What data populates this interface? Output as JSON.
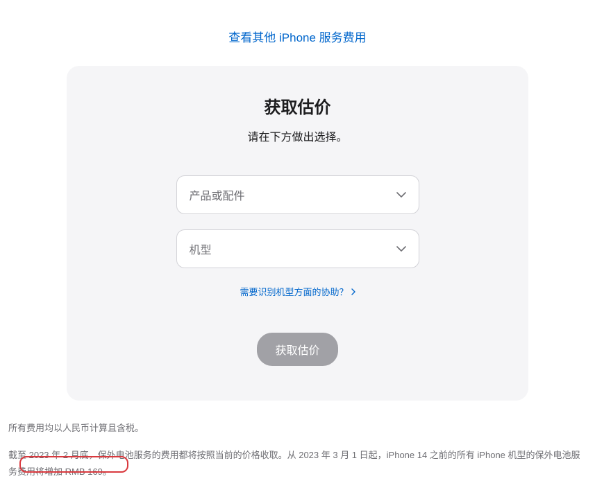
{
  "topLink": "查看其他 iPhone 服务费用",
  "card": {
    "title": "获取估价",
    "subtitle": "请在下方做出选择。",
    "select1Placeholder": "产品或配件",
    "select2Placeholder": "机型",
    "helpLink": "需要识别机型方面的协助？",
    "submitLabel": "获取估价"
  },
  "footnote": {
    "line1": "所有费用均以人民币计算且含税。",
    "line2": "截至 2023 年 2 月底，保外电池服务的费用都将按照当前的价格收取。从 2023 年 3 月 1 日起，iPhone 14 之前的所有 iPhone 机型的保外电池服务费用将增加 RMB 169。"
  }
}
